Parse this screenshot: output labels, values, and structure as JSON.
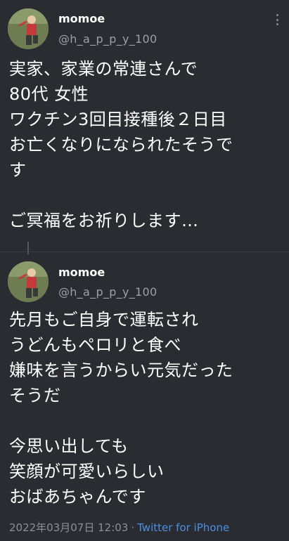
{
  "tweets": [
    {
      "user": {
        "name": "momoe",
        "handle": "@h_a_p_p_y_100"
      },
      "lines": [
        "実家、家業の常連さんで",
        "80代 女性",
        "ワクチン3回目接種後２日目",
        "お亡くなりになられたそうで",
        "す",
        "",
        "ご冥福をお祈りします…"
      ]
    },
    {
      "user": {
        "name": "momoe",
        "handle": "@h_a_p_p_y_100"
      },
      "lines": [
        "先月もご自身で運転され",
        "うどんもペロリと食べ",
        "嫌味を言うからい元気だった",
        "そうだ",
        "",
        "今思い出しても",
        "笑顔が可愛いらしい",
        "おばあちゃんです"
      ],
      "timestamp": "2022年03月07日 12:03",
      "separator": "·",
      "source": "Twitter for iPhone"
    }
  ],
  "icons": {
    "more": "more-vertical-icon",
    "avatar": "avatar-photo"
  },
  "colors": {
    "background": "#2a2c31",
    "text": "#ffffff",
    "secondary": "#9aa0a6",
    "link": "#4a90e2"
  }
}
